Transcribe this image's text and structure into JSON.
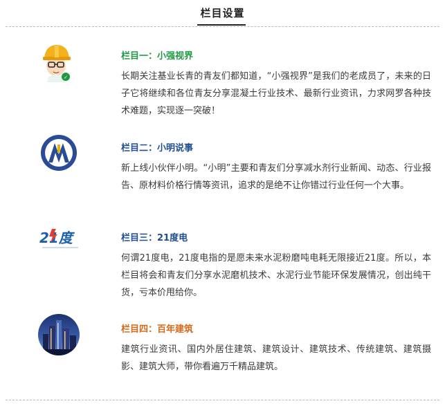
{
  "header": {
    "title": "栏目设置"
  },
  "colors": {
    "section1_title": "#1e9a45",
    "section2_title": "#1f4f8f",
    "section3_title": "#1f4f8f",
    "section4_title": "#d66a1b"
  },
  "sections": [
    {
      "title": "栏目一：小强视界",
      "body": "长期关注基业长青的青友们都知道，“小强视界”是我们的老成员了，未来的日子它将继续和各位青友分享混凝土行业技术、最新行业资讯，力求网罗各种技术难题，实现逐一突破！",
      "icon": "worker-helmet-icon"
    },
    {
      "title": "栏目二：小明说事",
      "body": "新上线小伙伴小明。“小明”主要和青友们分享减水剂行业新闻、动态、行业报告、原材料价格行情等资讯，追求的是绝不让你错过行业任何一个大事。",
      "icon": "m-logo-icon"
    },
    {
      "title": "栏目三：21度电",
      "body": "何谓21度电，21度电指的是愿未来水泥粉磨吨电耗无限接近21度。所以，本栏目将会和青友们分享水泥磨机技术、水泥行业节能环保发展情况，创出纯干货，亏本价甩给你。",
      "icon": "21du-logo-icon",
      "logo_text": "21度"
    },
    {
      "title": "栏目四：百年建筑",
      "body": "建筑行业资讯、国内外居住建筑、建筑设计、建筑技术、传统建筑、建筑摄影、建筑大师，带你看遍万千精品建筑。",
      "icon": "city-skyline-icon"
    }
  ]
}
